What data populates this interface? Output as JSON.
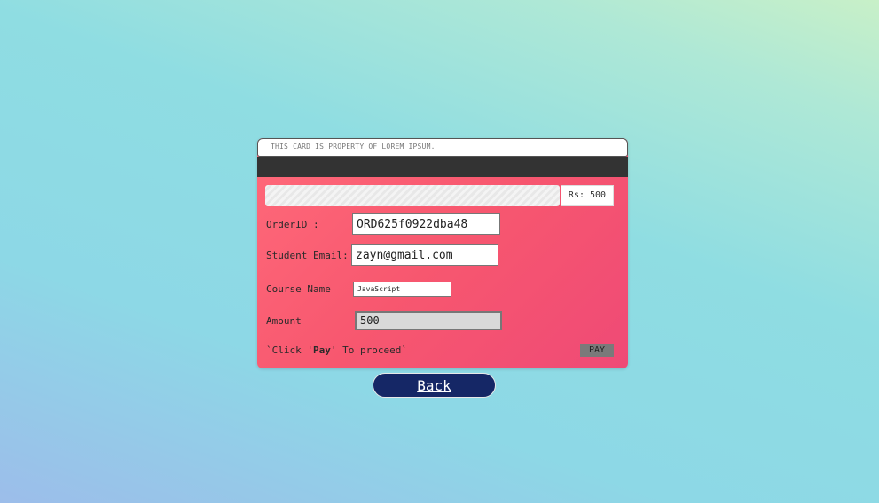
{
  "card": {
    "property_text": "THIS CARD IS PROPERTY OF LOREM IPSUM.",
    "amount_badge": "Rs: 500"
  },
  "form": {
    "order_label": "OrderID :",
    "order_value": "ORD625f0922dba48",
    "email_label": "Student Email:",
    "email_value": "zayn@gmail.com",
    "course_label": "Course Name",
    "course_value": "JavaScript",
    "amount_label": "Amount",
    "amount_value": "500"
  },
  "instruction": {
    "prefix": "`Click '",
    "bold": "Pay",
    "suffix": "' To proceed`"
  },
  "buttons": {
    "pay_label": "PAY",
    "back_label": "Back"
  },
  "colors": {
    "card_gradient_start": "#ff6a7a",
    "card_gradient_end": "#ef4a76",
    "stripe": "#333333",
    "back_button": "#152766",
    "pay_button": "#7a7a7a"
  }
}
